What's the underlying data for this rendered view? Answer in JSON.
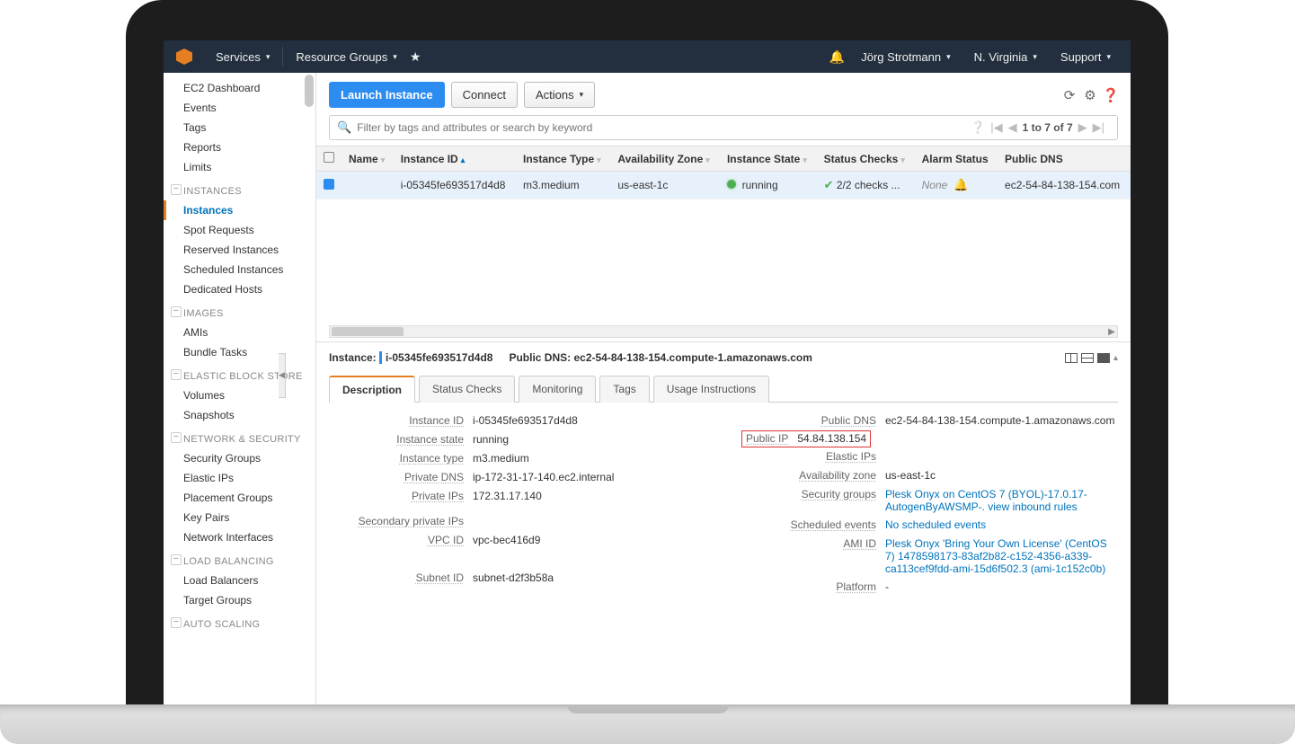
{
  "topnav": {
    "services": "Services",
    "resource_groups": "Resource Groups",
    "user": "Jörg Strotmann",
    "region": "N. Virginia",
    "support": "Support"
  },
  "sidebar": {
    "top": [
      "EC2 Dashboard",
      "Events",
      "Tags",
      "Reports",
      "Limits"
    ],
    "groups": [
      {
        "head": "INSTANCES",
        "items": [
          "Instances",
          "Spot Requests",
          "Reserved Instances",
          "Scheduled Instances",
          "Dedicated Hosts"
        ],
        "active": 0
      },
      {
        "head": "IMAGES",
        "items": [
          "AMIs",
          "Bundle Tasks"
        ]
      },
      {
        "head": "ELASTIC BLOCK STORE",
        "items": [
          "Volumes",
          "Snapshots"
        ]
      },
      {
        "head": "NETWORK & SECURITY",
        "items": [
          "Security Groups",
          "Elastic IPs",
          "Placement Groups",
          "Key Pairs",
          "Network Interfaces"
        ]
      },
      {
        "head": "LOAD BALANCING",
        "items": [
          "Load Balancers",
          "Target Groups"
        ]
      },
      {
        "head": "AUTO SCALING",
        "items": []
      }
    ]
  },
  "toolbar": {
    "launch": "Launch Instance",
    "connect": "Connect",
    "actions": "Actions"
  },
  "filter": {
    "placeholder": "Filter by tags and attributes or search by keyword",
    "pager": "1 to 7 of 7"
  },
  "table": {
    "cols": [
      "Name",
      "Instance ID",
      "Instance Type",
      "Availability Zone",
      "Instance State",
      "Status Checks",
      "Alarm Status",
      "Public DNS"
    ],
    "row": {
      "name": "",
      "instance_id": "i-05345fe693517d4d8",
      "instance_type": "m3.medium",
      "az": "us-east-1c",
      "state": "running",
      "checks": "2/2 checks ...",
      "alarm": "None",
      "dns": "ec2-54-84-138-154.com"
    }
  },
  "detail": {
    "instance_label": "Instance:",
    "instance_id": "i-05345fe693517d4d8",
    "dns_label": "Public DNS:",
    "dns": "ec2-54-84-138-154.compute-1.amazonaws.com",
    "tabs": [
      "Description",
      "Status Checks",
      "Monitoring",
      "Tags",
      "Usage Instructions"
    ],
    "left": [
      {
        "k": "Instance ID",
        "v": "i-05345fe693517d4d8"
      },
      {
        "k": "Instance state",
        "v": "running"
      },
      {
        "k": "Instance type",
        "v": "m3.medium"
      },
      {
        "k": "Private DNS",
        "v": "ip-172-31-17-140.ec2.internal"
      },
      {
        "k": "Private IPs",
        "v": "172.31.17.140"
      },
      {
        "k": "",
        "v": ""
      },
      {
        "k": "Secondary private IPs",
        "v": ""
      },
      {
        "k": "VPC ID",
        "v": "vpc-bec416d9"
      },
      {
        "k": "",
        "v": ""
      },
      {
        "k": "",
        "v": ""
      },
      {
        "k": "",
        "v": ""
      },
      {
        "k": "Subnet ID",
        "v": "subnet-d2f3b58a"
      }
    ],
    "right": [
      {
        "k": "Public DNS",
        "v": "ec2-54-84-138-154.compute-1.amazonaws.com"
      },
      {
        "k": "Public IP",
        "v": "54.84.138.154",
        "hl": true
      },
      {
        "k": "Elastic IPs",
        "v": ""
      },
      {
        "k": "Availability zone",
        "v": "us-east-1c"
      },
      {
        "k": "Security groups",
        "v": "Plesk Onyx on CentOS 7 (BYOL)-17.0.17-AutogenByAWSMP-.  view inbound rules",
        "link": true
      },
      {
        "k": "Scheduled events",
        "v": "No scheduled events",
        "link": true
      },
      {
        "k": "AMI ID",
        "v": "Plesk Onyx 'Bring Your Own License' (CentOS 7) 1478598173-83af2b82-c152-4356-a339-ca113cef9fdd-ami-15d6f502.3 (ami-1c152c0b)",
        "link": true
      },
      {
        "k": "Platform",
        "v": "-"
      }
    ]
  }
}
